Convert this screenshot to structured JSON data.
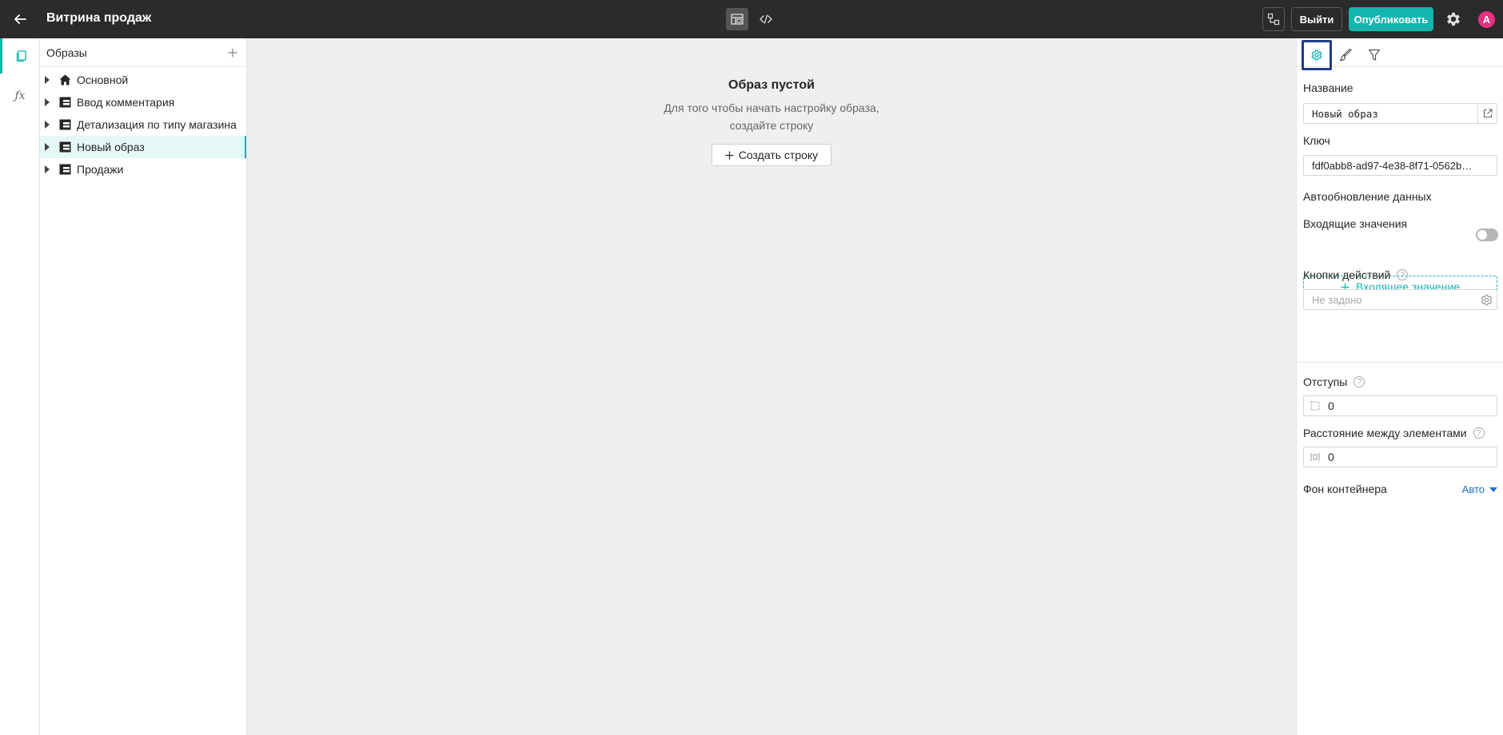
{
  "header": {
    "title": "Витрина продаж",
    "exit_label": "Выйти",
    "publish_label": "Опубликовать",
    "avatar_initial": "А"
  },
  "tree": {
    "title": "Образы",
    "items": [
      {
        "label": "Основной",
        "icon": "home-icon"
      },
      {
        "label": "Ввод комментария",
        "icon": "table-icon"
      },
      {
        "label": "Детализация по типу магазина",
        "icon": "table-icon"
      },
      {
        "label": "Новый образ",
        "icon": "table-icon",
        "selected": true
      },
      {
        "label": "Продажи",
        "icon": "table-icon"
      }
    ]
  },
  "canvas": {
    "empty_title": "Образ пустой",
    "empty_desc": "Для того чтобы начать настройку образа, создайте строку",
    "create_row_label": "Создать строку"
  },
  "props": {
    "name_label": "Название",
    "name_value": "Новый образ",
    "key_label": "Ключ",
    "key_value": "fdf0abb8-ad97-4e38-8f71-0562b…",
    "autoupdate_label": "Автообновление данных",
    "autoupdate_on": false,
    "incoming_label": "Входящие значения",
    "incoming_button": "Входящее значение",
    "actions_label": "Кнопки действий",
    "actions_placeholder": "Не задано",
    "padding_label": "Отступы",
    "padding_value": "0",
    "gap_label": "Расстояние между элементами",
    "gap_value": "0",
    "bg_label": "Фон контейнера",
    "bg_value": "Авто"
  },
  "colors": {
    "accent": "#13b5ae",
    "topbar": "#2b2b2b",
    "avatar": "#e6317f",
    "link": "#1a6fd6",
    "active_tab_outline": "#1f3a8a"
  }
}
